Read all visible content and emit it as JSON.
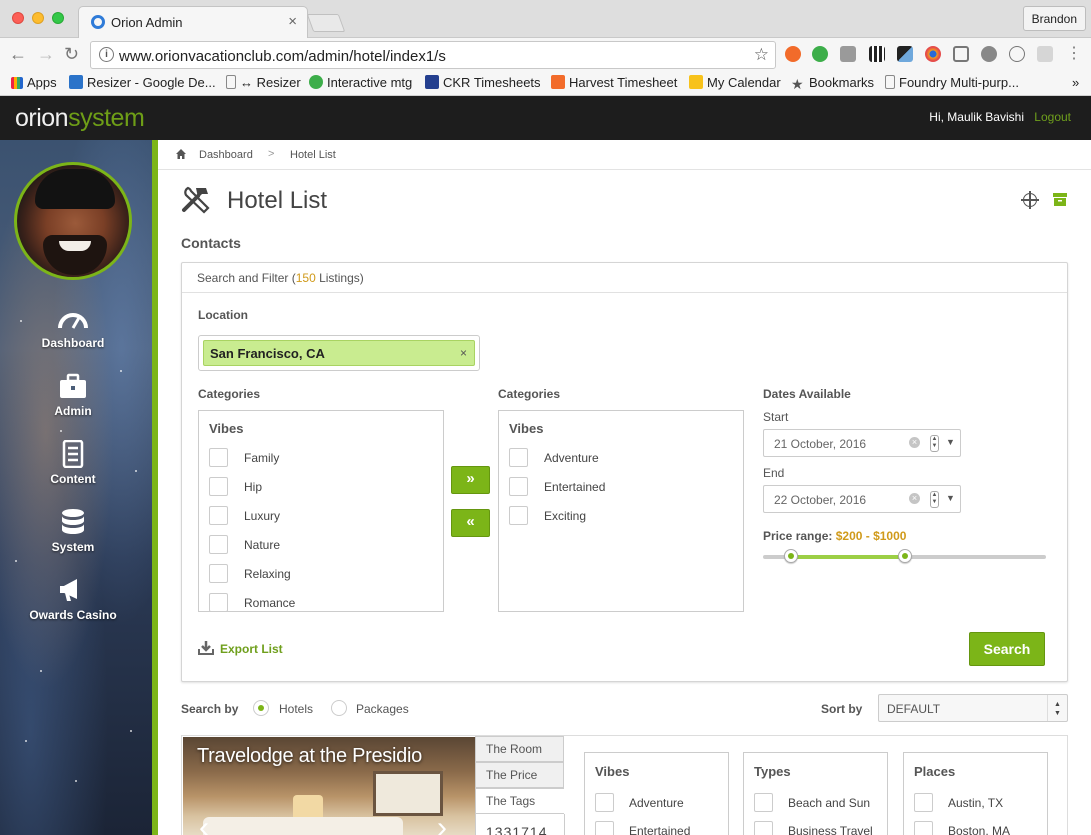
{
  "browser": {
    "tab_title": "Orion Admin",
    "tab_close": "×",
    "user_button": "Brandon",
    "url": "www.orionvacationclub.com/admin/hotel/index1/s",
    "bookmarks": [
      "Apps",
      "Resizer - Google De...",
      "↔ Resizer",
      "Interactive mtg",
      "CKR Timesheets",
      "Harvest Timesheet",
      "My Calendar",
      "Bookmarks",
      "Foundry Multi-purp..."
    ],
    "bookmarks_more": "»"
  },
  "header": {
    "logo_part1": "orion",
    "logo_part2": "system",
    "greeting": "Hi, Maulik Bavishi",
    "logout": "Logout"
  },
  "sidebar": {
    "items": [
      {
        "label": "Dashboard",
        "icon": "speedometer-icon"
      },
      {
        "label": "Admin",
        "icon": "briefcase-icon"
      },
      {
        "label": "Content",
        "icon": "document-icon"
      },
      {
        "label": "System",
        "icon": "database-icon"
      },
      {
        "label": "Owards Casino",
        "icon": "megaphone-icon"
      }
    ]
  },
  "breadcrumb": {
    "home": "Dashboard",
    "separator": ">",
    "current": "Hotel List"
  },
  "page": {
    "title": "Hotel List",
    "section": "Contacts"
  },
  "filter": {
    "head_prefix": "Search and Filter (",
    "head_count": "150",
    "head_suffix": " Listings)",
    "location_label": "Location",
    "location_value": "San Francisco, CA",
    "location_clear": "×",
    "categories_left_label": "Categories",
    "categories_right_label": "Categories",
    "left_list_head": "Vibes",
    "left_items": [
      "Family",
      "Hip",
      "Luxury",
      "Nature",
      "Relaxing",
      "Romance"
    ],
    "right_list_head": "Vibes",
    "right_items": [
      "Adventure",
      "Entertained",
      "Exciting"
    ],
    "move_right": "»",
    "move_left": "«",
    "dates_label": "Dates Available",
    "start_label": "Start",
    "start_value": "21 October, 2016",
    "end_label": "End",
    "end_value": "22 October, 2016",
    "date_clear": "×",
    "date_caret": "▼",
    "price_label": "Price range:",
    "price_value": "$200 - $1000",
    "price_range_fraction": [
      0.1,
      0.5
    ],
    "export_label": "Export List",
    "search_button": "Search"
  },
  "searchbar": {
    "search_by_label": "Search by",
    "option_hotels": "Hotels",
    "option_packages": "Packages",
    "sort_by_label": "Sort by",
    "sort_value": "DEFAULT"
  },
  "hotel": {
    "name": "Travelodge at the Presidio",
    "tabs": [
      "The Room",
      "The Price",
      "The Tags"
    ],
    "number": "1331714",
    "vibes_head": "Vibes",
    "vibes": [
      "Adventure",
      "Entertained"
    ],
    "types_head": "Types",
    "types": [
      "Beach and Sun",
      "Business Travel"
    ],
    "places_head": "Places",
    "places": [
      "Austin, TX",
      "Boston, MA"
    ]
  },
  "colors": {
    "accent_green": "#7cb518",
    "accent_orange": "#d09a1a",
    "header_bg": "#1d1d1d"
  }
}
